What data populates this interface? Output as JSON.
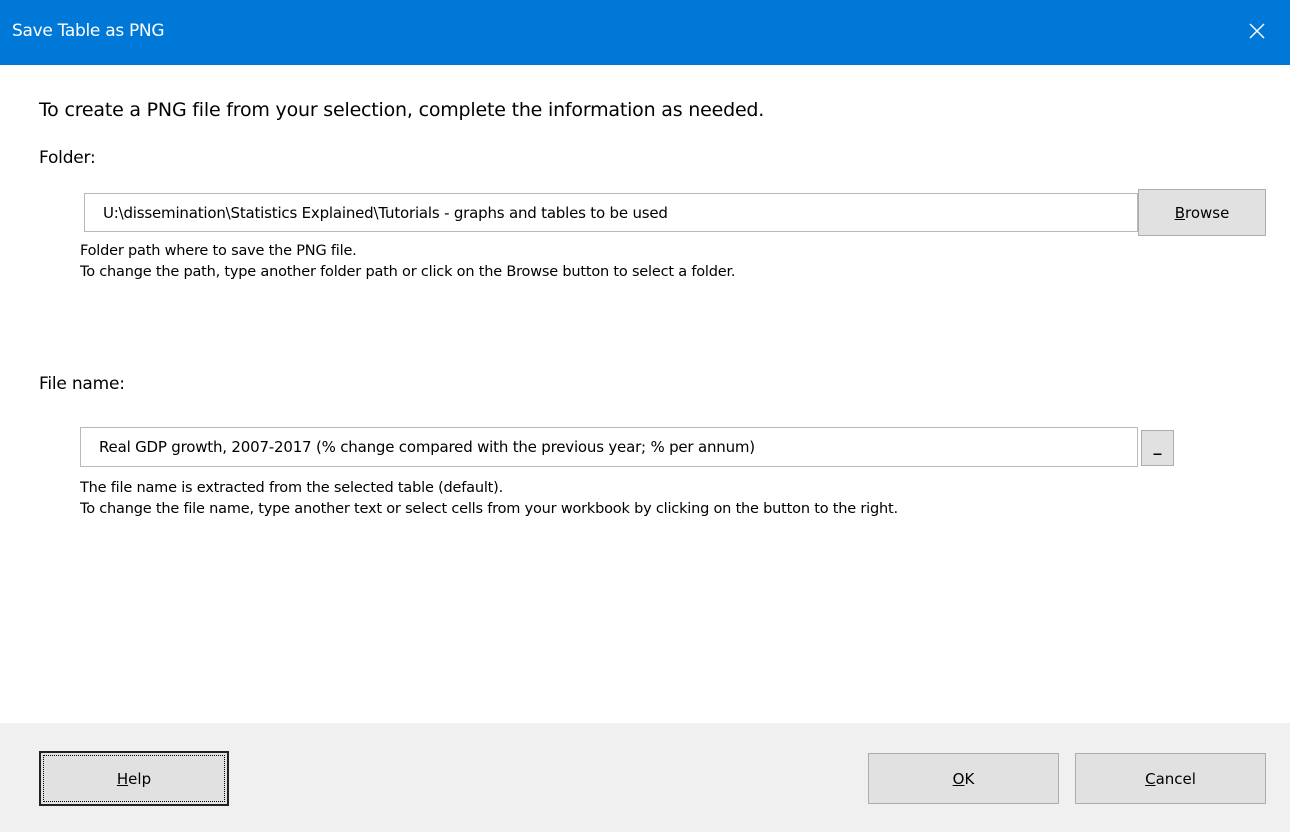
{
  "window": {
    "title": "Save Table as PNG",
    "close_icon": "close-icon"
  },
  "intro_text": "To create a PNG file from your selection, complete the information as needed.",
  "folder": {
    "label": "Folder:",
    "value": "U:\\dissemination\\Statistics Explained\\Tutorials - graphs and tables to be used",
    "browse_label_u": "B",
    "browse_label_rest": "rowse",
    "hint_line1": "Folder path where to save the PNG file.",
    "hint_line2": "To change the path, type another folder path or click on the Browse button to select a folder."
  },
  "filename": {
    "label": "File name:",
    "value": "Real GDP growth, 2007-2017 (% change compared with the previous year; % per annum)",
    "select_button_label": "_",
    "hint_line1": "The file name is extracted from the selected table (default).",
    "hint_line2": "To change the file name, type another text or select cells from your workbook by clicking on the button to the right."
  },
  "footer": {
    "help_label_u": "H",
    "help_label_rest": "elp",
    "ok_label_u": "O",
    "ok_label_rest": "K",
    "cancel_label_u": "C",
    "cancel_label_rest": "ancel"
  },
  "colors": {
    "titlebar": "#0078d7",
    "footer": "#f0f0f0",
    "button": "#e1e1e1"
  }
}
